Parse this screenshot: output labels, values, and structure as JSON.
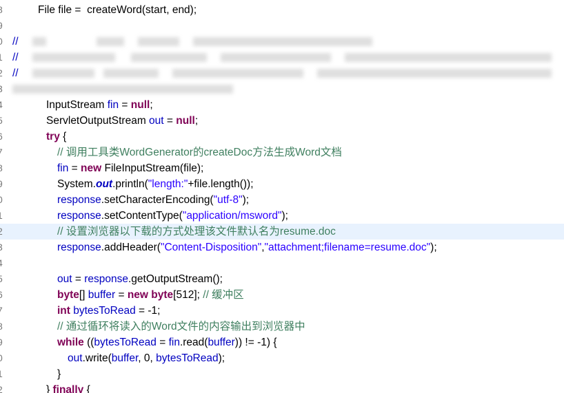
{
  "editor": {
    "gutter": [
      "8",
      "9",
      "0",
      "1",
      "2",
      "3",
      "4",
      "5",
      "6",
      "7",
      "8",
      "9",
      "0",
      "1",
      "2",
      "3",
      "4",
      "5",
      "6",
      "7",
      "8",
      "9",
      "0",
      "1",
      "2"
    ],
    "colors": {
      "keyword": "#7f0055",
      "string": "#2a00ff",
      "comment": "#3f7f5f",
      "field": "#0000c0",
      "highlight": "#e8f2fe"
    },
    "lines": [
      [
        {
          "t": "File file =  createWord(start, end);"
        }
      ],
      [],
      [
        {
          "t": "//",
          "c": "fld"
        }
      ],
      [
        {
          "t": "//",
          "c": "fld"
        }
      ],
      [
        {
          "t": "//",
          "c": "fld"
        }
      ],
      [],
      [
        {
          "t": "InputStream "
        },
        {
          "t": "fin",
          "c": "fld"
        },
        {
          "t": " = "
        },
        {
          "t": "null",
          "c": "kw"
        },
        {
          "t": ";"
        }
      ],
      [
        {
          "t": "ServletOutputStream "
        },
        {
          "t": "out",
          "c": "fld"
        },
        {
          "t": " = "
        },
        {
          "t": "null",
          "c": "kw"
        },
        {
          "t": ";"
        }
      ],
      [
        {
          "t": "try",
          "c": "kw"
        },
        {
          "t": " {"
        }
      ],
      [
        {
          "t": "// 调用工具类WordGenerator的createDoc方法生成Word文档",
          "c": "cmt"
        }
      ],
      [
        {
          "t": "fin",
          "c": "fld"
        },
        {
          "t": " = "
        },
        {
          "t": "new",
          "c": "kw"
        },
        {
          "t": " FileInputStream(file);"
        }
      ],
      [
        {
          "t": "System."
        },
        {
          "t": "out",
          "c": "sfld"
        },
        {
          "t": ".println("
        },
        {
          "t": "\"length:\"",
          "c": "str"
        },
        {
          "t": "+file.length());"
        }
      ],
      [
        {
          "t": "response",
          "c": "fld"
        },
        {
          "t": ".setCharacterEncoding("
        },
        {
          "t": "\"utf-8\"",
          "c": "str"
        },
        {
          "t": ");"
        }
      ],
      [
        {
          "t": "response",
          "c": "fld"
        },
        {
          "t": ".setContentType("
        },
        {
          "t": "\"application/msword\"",
          "c": "str"
        },
        {
          "t": ");"
        }
      ],
      [
        {
          "t": "// 设置浏览器以下载的方式处理该文件默认名为resume.doc",
          "c": "cmt"
        }
      ],
      [
        {
          "t": "response",
          "c": "fld"
        },
        {
          "t": ".addHeader("
        },
        {
          "t": "\"Content-Disposition\"",
          "c": "str"
        },
        {
          "t": ","
        },
        {
          "t": "\"attachment;filename=resume.doc\"",
          "c": "str"
        },
        {
          "t": ");"
        }
      ],
      [],
      [
        {
          "t": "out",
          "c": "fld"
        },
        {
          "t": " = "
        },
        {
          "t": "response",
          "c": "fld"
        },
        {
          "t": ".getOutputStream();"
        }
      ],
      [
        {
          "t": "byte",
          "c": "kw"
        },
        {
          "t": "[] "
        },
        {
          "t": "buffer",
          "c": "fld"
        },
        {
          "t": " = "
        },
        {
          "t": "new",
          "c": "kw"
        },
        {
          "t": " "
        },
        {
          "t": "byte",
          "c": "kw"
        },
        {
          "t": "[512]; "
        },
        {
          "t": "// 缓冲区",
          "c": "cmt"
        }
      ],
      [
        {
          "t": "int",
          "c": "kw"
        },
        {
          "t": " "
        },
        {
          "t": "bytesToRead",
          "c": "fld"
        },
        {
          "t": " = -1;"
        }
      ],
      [
        {
          "t": "// 通过循环将读入的Word文件的内容输出到浏览器中",
          "c": "cmt"
        }
      ],
      [
        {
          "t": "while",
          "c": "kw"
        },
        {
          "t": " (("
        },
        {
          "t": "bytesToRead",
          "c": "fld"
        },
        {
          "t": " = "
        },
        {
          "t": "fin",
          "c": "fld"
        },
        {
          "t": ".read("
        },
        {
          "t": "buffer",
          "c": "fld"
        },
        {
          "t": ")) != -1) {"
        }
      ],
      [
        {
          "t": "out",
          "c": "fld"
        },
        {
          "t": ".write("
        },
        {
          "t": "buffer",
          "c": "fld"
        },
        {
          "t": ", 0, "
        },
        {
          "t": "bytesToRead",
          "c": "fld"
        },
        {
          "t": ");"
        }
      ],
      [
        {
          "t": "}"
        }
      ],
      [
        {
          "t": "} "
        },
        {
          "t": "finally",
          "c": "kw"
        },
        {
          "t": " {"
        }
      ]
    ]
  }
}
